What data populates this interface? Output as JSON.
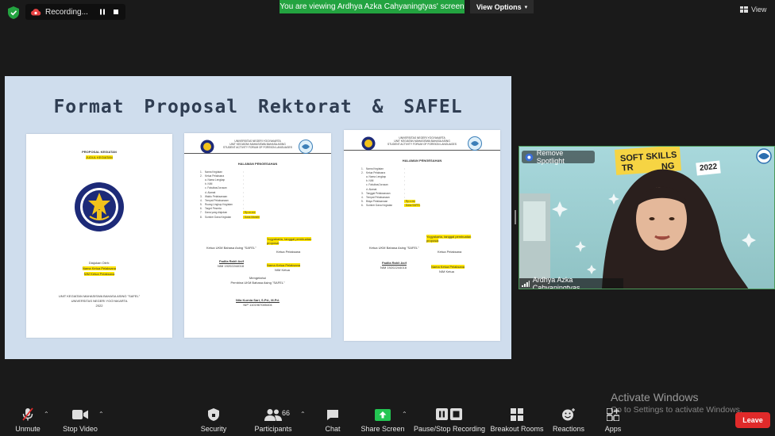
{
  "topbar": {
    "recording_label": "Recording...",
    "viewing_banner": "You are viewing Ardhya Azka Cahyaningtyas' screen",
    "view_options_label": "View Options",
    "view_label": "View"
  },
  "slide": {
    "title": "Format Proposal Rektorat & SAFEL",
    "doc1": {
      "heading": "PROPOSAL KEGIATAN",
      "subheading": "JUDUL KEGIATAN",
      "logo_text": "UNIVERSITAS NEGERI YOGYAKARTA",
      "diajukan": "Diajukan Oleh:",
      "nama_ketua": "Nama Ketua Pelaksana",
      "nim_ketua": "NIM Ketua Pelaksana",
      "footer1": "UNIT KEGIATAN MAHASISWA BAHASA ASING \"SAFEL\"",
      "footer2": "UNIVERSITAS NEGERI YOGYAKARTA",
      "footer3": "2022"
    },
    "doc2": {
      "kop1": "UNIVERSITAS NEGERI YOGYAKARTA",
      "kop2": "UNIT KEGIATAN MAHASISWA BAHASA ASING",
      "kop3": "STUDENT ACTIVITY FORUM OF FOREIGN LANGUAGES",
      "page_title": "HALAMAN PENGESAHAN",
      "fields": [
        {
          "n": "1.",
          "k": "Nama Kegiatan",
          "v": ":"
        },
        {
          "n": "2.",
          "k": "Ketua Pelaksana",
          "v": ":"
        },
        {
          "n": "",
          "k": "a. Nama Lengkap",
          "v": ":"
        },
        {
          "n": "",
          "k": "b. NIM",
          "v": ":"
        },
        {
          "n": "",
          "k": "c. Fakultas/Jurusan",
          "v": ":"
        },
        {
          "n": "",
          "k": "d. Alamat",
          "v": ":"
        },
        {
          "n": "3.",
          "k": "Waktu Pelaksanaan",
          "v": ":"
        },
        {
          "n": "4.",
          "k": "Tempat Pelaksanaan",
          "v": ":"
        },
        {
          "n": "5.",
          "k": "Ruang Lingkup Kegiatan",
          "v": ":"
        },
        {
          "n": "6.",
          "k": "Target Peserta",
          "v": ":"
        },
        {
          "n": "7.",
          "k": "Dana yang diajukan",
          "v": ": Rp.xx.xxx"
        },
        {
          "n": "8.",
          "k": "Sumber Dana Kegiatan",
          "v": ": Dana Mandiri"
        }
      ],
      "place_date": "Yogyakarta, tanggal pembuatan proposal",
      "ketua_ukm": "Ketua UKM Bahasa Asing \"SAFEL\"",
      "ketua_pelaksana": "Ketua Pelaksana",
      "sig1_name": "Fadila Rahli Asif",
      "sig1_nim": "NIM 19202244018",
      "sig2_name": "Nama Ketua Pelaksana",
      "sig2_nim": "NIM Ketua",
      "mengetahui": "Mengetahui",
      "pembina": "Pembina UKM Bahasa Asing \"SAFEL\"",
      "sig3_name": "Nila Kurnia Sari, S.Pd., M.Pd.",
      "sig3_nip": "NIP 1101967085404"
    },
    "doc3": {
      "kop1": "UNIVERSITAS NEGERI YOGYAKARTA",
      "kop2": "UNIT KEGIATAN MAHASISWA BAHASA ASING",
      "kop3": "STUDENT ACTIVITY FORUM OF FOREIGN LANGUAGES",
      "page_title": "HALAMAN PENGESAHAN",
      "fields": [
        {
          "n": "1.",
          "k": "Nama Kegiatan",
          "v": ":"
        },
        {
          "n": "2.",
          "k": "Ketua Pelaksana",
          "v": ":"
        },
        {
          "n": "",
          "k": "a. Nama Lengkap",
          "v": ":"
        },
        {
          "n": "",
          "k": "b. NIM",
          "v": ":"
        },
        {
          "n": "",
          "k": "c. Fakultas/Jurusan",
          "v": ":"
        },
        {
          "n": "",
          "k": "d. Alamat",
          "v": ":"
        },
        {
          "n": "3.",
          "k": "Tanggal Pelaksanaan",
          "v": ":"
        },
        {
          "n": "4.",
          "k": "Tempat Pelaksanaan",
          "v": ":"
        },
        {
          "n": "5.",
          "k": "Biaya Pelaksanaan",
          "v": ": Rp.x.xxx"
        },
        {
          "n": "6.",
          "k": "Sumber Dana Kegiatan",
          "v": ": Dana SAFEL"
        }
      ],
      "place_date": "Yogyakarta, tanggal pembuatan proposal",
      "ketua_ukm": "Ketua UKM Bahasa Asing \"SAFEL\"",
      "ketua_pelaksana": "Ketua Pelaksana",
      "sig1_name": "Fadila Rahli Asif",
      "sig1_nim": "NIM 19202244018",
      "sig2_name": "Nama Ketua Pelaksana",
      "sig2_nim": "NIM Ketua"
    }
  },
  "video": {
    "remove_spotlight": "Remove Spotlight",
    "participant_name": "Ardhya Azka Cahyaningtyas",
    "banner_line1": "SOFT SKILLS",
    "banner_line2": "TR",
    "banner_line3": "NG",
    "banner_year": "2022"
  },
  "watermark": {
    "line1": "Activate Windows",
    "line2": "Go to Settings to activate Windows."
  },
  "toolbar": {
    "unmute": "Unmute",
    "stop_video": "Stop Video",
    "security": "Security",
    "participants": "Participants",
    "participant_count": "66",
    "chat": "Chat",
    "share_screen": "Share Screen",
    "pause_recording": "Pause/Stop Recording",
    "breakout": "Breakout Rooms",
    "reactions": "Reactions",
    "apps": "Apps",
    "leave": "Leave"
  },
  "colors": {
    "banner_green": "#23a340",
    "leave_red": "#e02a2a",
    "highlight_yellow": "#ffe400"
  }
}
